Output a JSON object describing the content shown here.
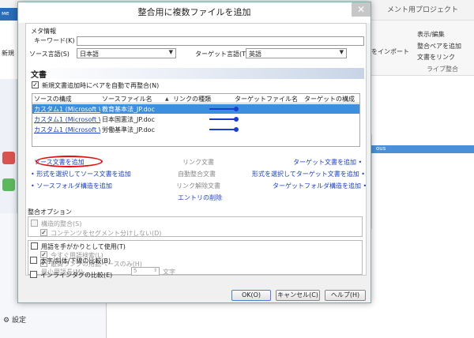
{
  "background": {
    "app_tab": "ме",
    "window_title": "メント用プロジェクト",
    "left_label": "新規",
    "ribbon": {
      "display_edit": "表示/編集",
      "add_pair": "整合ペアを追加",
      "link_docs": "文書をリンク",
      "import": "をインポート",
      "group_label": "ライブ整合"
    },
    "selected_item": "ous",
    "settings": "設定"
  },
  "dialog": {
    "title": "整合用に複数ファイルを追加",
    "close_label": "✕",
    "meta": {
      "section": "メタ情報",
      "keyword_label": "キーワード(K)",
      "keyword_value": "",
      "source_lang_label": "ソース言語(S)",
      "source_lang_value": "日本語",
      "target_lang_label": "ターゲット言語(T)",
      "target_lang_value": "英語"
    },
    "documents": {
      "section": "文書",
      "auto_align_label": "新規文書追加時にペアを自動で再整合(N)",
      "auto_align_checked": true,
      "columns": [
        "ソースの構成",
        "ソースファイル名",
        "リンクの種類",
        "ターゲットファイル名",
        "ターゲットの構成"
      ],
      "rows": [
        {
          "source_config": "カスタム1 (Microsoft Word...",
          "source_file": "教育基本法_JP.doc",
          "target_file": "",
          "target_config": "",
          "selected": true
        },
        {
          "source_config": "カスタム1 (Microsoft Word...",
          "source_file": "日本国憲法_JP.doc",
          "target_file": "",
          "target_config": "",
          "selected": false
        },
        {
          "source_config": "カスタム1 (Microsoft Word...",
          "source_file": "労働基準法_JP.doc",
          "target_file": "",
          "target_config": "",
          "selected": false
        }
      ],
      "actions": {
        "add_source": "ソース文書を追加",
        "add_source_by_format": "• 形式を選択してソース文書を追加",
        "add_source_folder": "• ソースフォルダ構造を追加",
        "link_docs": "リンク文書",
        "auto_align": "自動整合文書",
        "unlink": "リンク解除文書",
        "delete_entry": "エントリの削除",
        "add_target": "ターゲット文書を追加 •",
        "add_target_by_format": "形式を選択してターゲット文書を追加 •",
        "add_target_folder": "ターゲットフォルダ構造を追加 •"
      }
    },
    "options": {
      "section": "整合オプション",
      "structural_label": "構造的整合(S)",
      "structural_checked": false,
      "no_segment_label": "コンテンツをセグメント分けしない(D)",
      "no_segment_checked": true,
      "use_terms_label": "用語を手がかりとして使用(T)",
      "use_terms_checked": false,
      "search_terms_label": "今すぐ用語検索(L)",
      "search_terms_checked": true,
      "top_rank_label": "最高ランクの用語ベースのみ(H)",
      "top_rank_checked": true,
      "min_term_length_label": "最小用語長(M)",
      "min_term_length_value": "5",
      "min_term_length_unit": "文字",
      "bold_italic_label": "太字/斜体/下線の比較(B)",
      "bold_italic_checked": false,
      "inline_tags_label": "インラインタグの比較(E)",
      "inline_tags_checked": false
    },
    "buttons": {
      "ok": "OK(O)",
      "cancel": "キャンセル(C)",
      "help": "ヘルプ(H)"
    }
  }
}
